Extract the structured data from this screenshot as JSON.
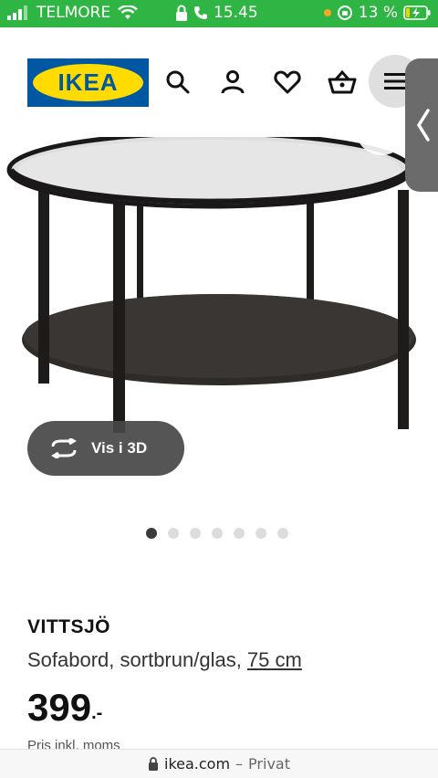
{
  "status_bar": {
    "carrier": "TELMORE",
    "time": "15.45",
    "battery": "13 %",
    "background": "#2fb544"
  },
  "header": {
    "logo_text": "IKEA",
    "brand_blue": "#0058a3",
    "brand_yellow": "#ffdb00",
    "icons": [
      "search-icon",
      "user-icon",
      "heart-icon",
      "basket-icon",
      "menu-icon"
    ]
  },
  "view_3d": {
    "label": "Vis i 3D",
    "icon": "rotate-icon"
  },
  "carousel": {
    "count": 7,
    "active_index": 0
  },
  "product": {
    "name": "VITTSJÖ",
    "description": "Sofabord, sortbrun/glas, ",
    "size": "75 cm",
    "price": "399",
    "price_suffix": ".-",
    "price_note": "Pris inkl. moms"
  },
  "url_bar": {
    "domain": "ikea.com",
    "separator": "–",
    "mode": "Privat"
  }
}
